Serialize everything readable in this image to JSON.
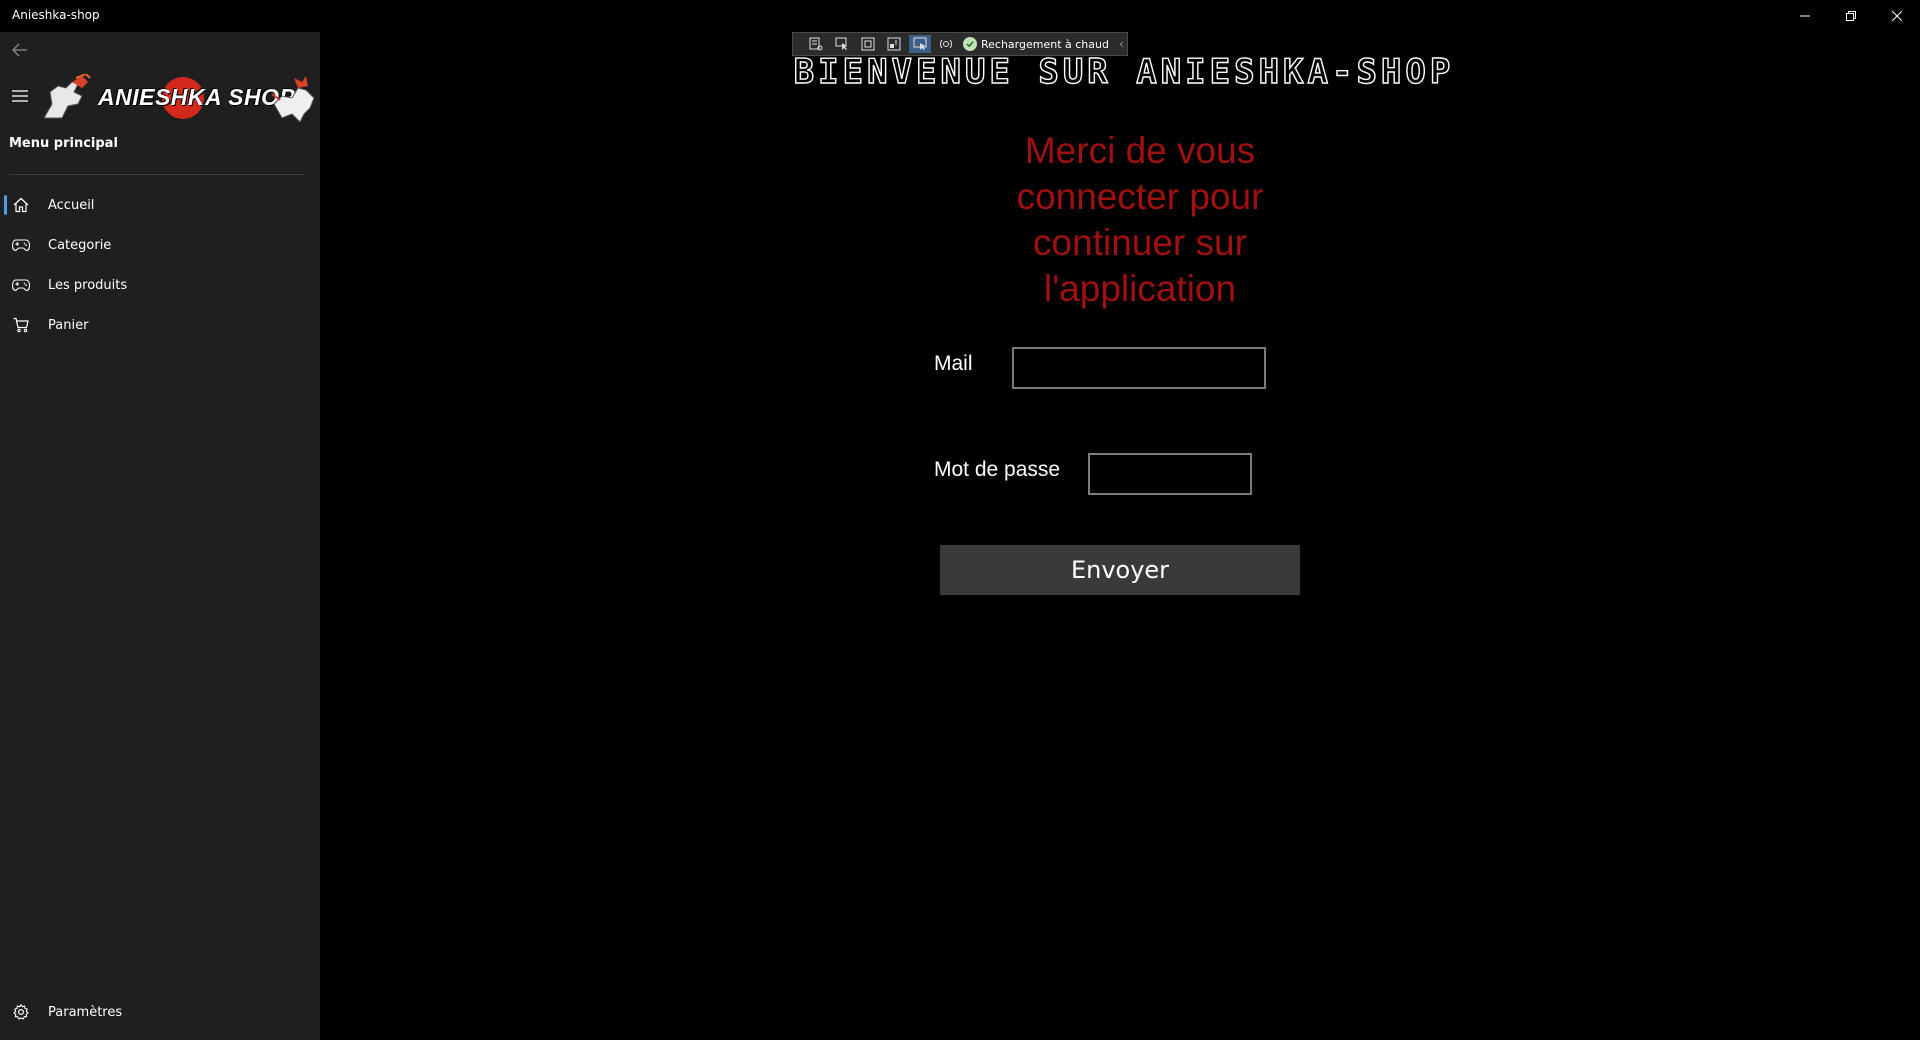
{
  "window": {
    "title": "Anieshka-shop",
    "controls": [
      "minimize-icon",
      "restore-icon",
      "close-icon"
    ]
  },
  "sidebar": {
    "back_icon": "back-arrow-icon",
    "menu_icon": "hamburger-icon",
    "logo_text": "ANIESHKA SHOP",
    "heading": "Menu principal",
    "items": [
      {
        "label": "Accueil",
        "icon": "home-icon",
        "selected": true
      },
      {
        "label": "Categorie",
        "icon": "gamepad-icon",
        "selected": false
      },
      {
        "label": "Les produits",
        "icon": "gamepad-icon",
        "selected": false
      },
      {
        "label": "Panier",
        "icon": "cart-icon",
        "selected": false
      }
    ],
    "footer": {
      "label": "Paramètres",
      "icon": "gear-icon"
    }
  },
  "debug_toolbar": {
    "status": "Rechargement à chaud"
  },
  "main": {
    "welcome_title": "BIENVENUE SUR ANIESHKA-SHOP",
    "login_message": "Merci de vous connecter pour continuer sur l'application",
    "mail_label": "Mail",
    "mail_value": "",
    "password_label": "Mot de passe",
    "password_value": "",
    "submit_label": "Envoyer"
  },
  "colors": {
    "background": "#000000",
    "sidebar": "#1f1f1f",
    "accent": "#4aa0e6",
    "message": "#a01010",
    "button": "#3a3a3a"
  }
}
